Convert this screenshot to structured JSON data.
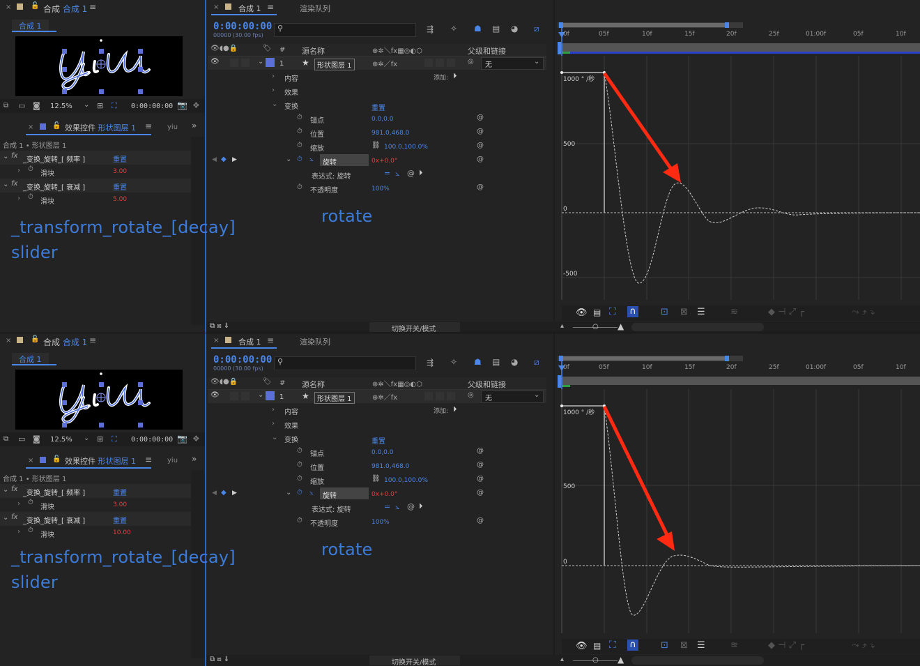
{
  "comp_panel": {
    "title_prefix": "合成",
    "title_name": "合成 1",
    "tab": "合成 1",
    "preview_text": "yiu",
    "zoom": "12.5%",
    "timecode": "0:00:00:00"
  },
  "effect_panel": {
    "title_prefix": "效果控件",
    "layer": "形状图层 1",
    "extra_tab": "yiu",
    "breadcrumb": "合成 1 • 形状图层 1",
    "fx1_name": "_变换_旋转_[ 频率 ]",
    "fx2_name": "_变换_旋转_[ 衰减 ]",
    "reset": "重置",
    "slider_label": "滑块"
  },
  "timeline": {
    "tab_comp": "合成 1",
    "tab_render": "渲染队列",
    "timecode": "0:00:00:00",
    "fps": "00000 (30.00 fps)",
    "col_source": "源名称",
    "col_parent": "父级和链接",
    "layer_num": "1",
    "layer_name": "形状图层 1",
    "parent_value": "无",
    "add_label": "添加:",
    "content": "内容",
    "effects": "效果",
    "transform": "变换",
    "reset": "重置",
    "anchor": "锚点",
    "anchor_val": "0.0,0.0",
    "position": "位置",
    "position_val": "981.0,468.0",
    "scale": "缩放",
    "scale_val": "100.0,100.0%",
    "rotation": "旋转",
    "rotation_val": "0x+0.0°",
    "expression_label": "表达式: 旋转",
    "opacity": "不透明度",
    "opacity_val": "100%",
    "switch_mode": "切换开关/模式"
  },
  "overlay": {
    "line1": "_transform_rotate_[decay]",
    "line2": "slider",
    "rotate": "rotate"
  },
  "graph": {
    "unit_label": "1000 ° /秒",
    "y500": "500",
    "y0": "0",
    "yneg500": "-500",
    "ticks": [
      "0f",
      "05f",
      "10f",
      "15f",
      "20f",
      "25f",
      "01:00f",
      "05f",
      "10f"
    ]
  },
  "top": {
    "freq_val": "3.00",
    "decay_val": "5.00"
  },
  "bottom": {
    "freq_val": "3.00",
    "decay_val": "10.00"
  },
  "colors": {
    "accent": "#4a86e8",
    "arrow": "#ff2a12",
    "value_red": "#e04040",
    "layer_label": "#5b6fd6"
  }
}
